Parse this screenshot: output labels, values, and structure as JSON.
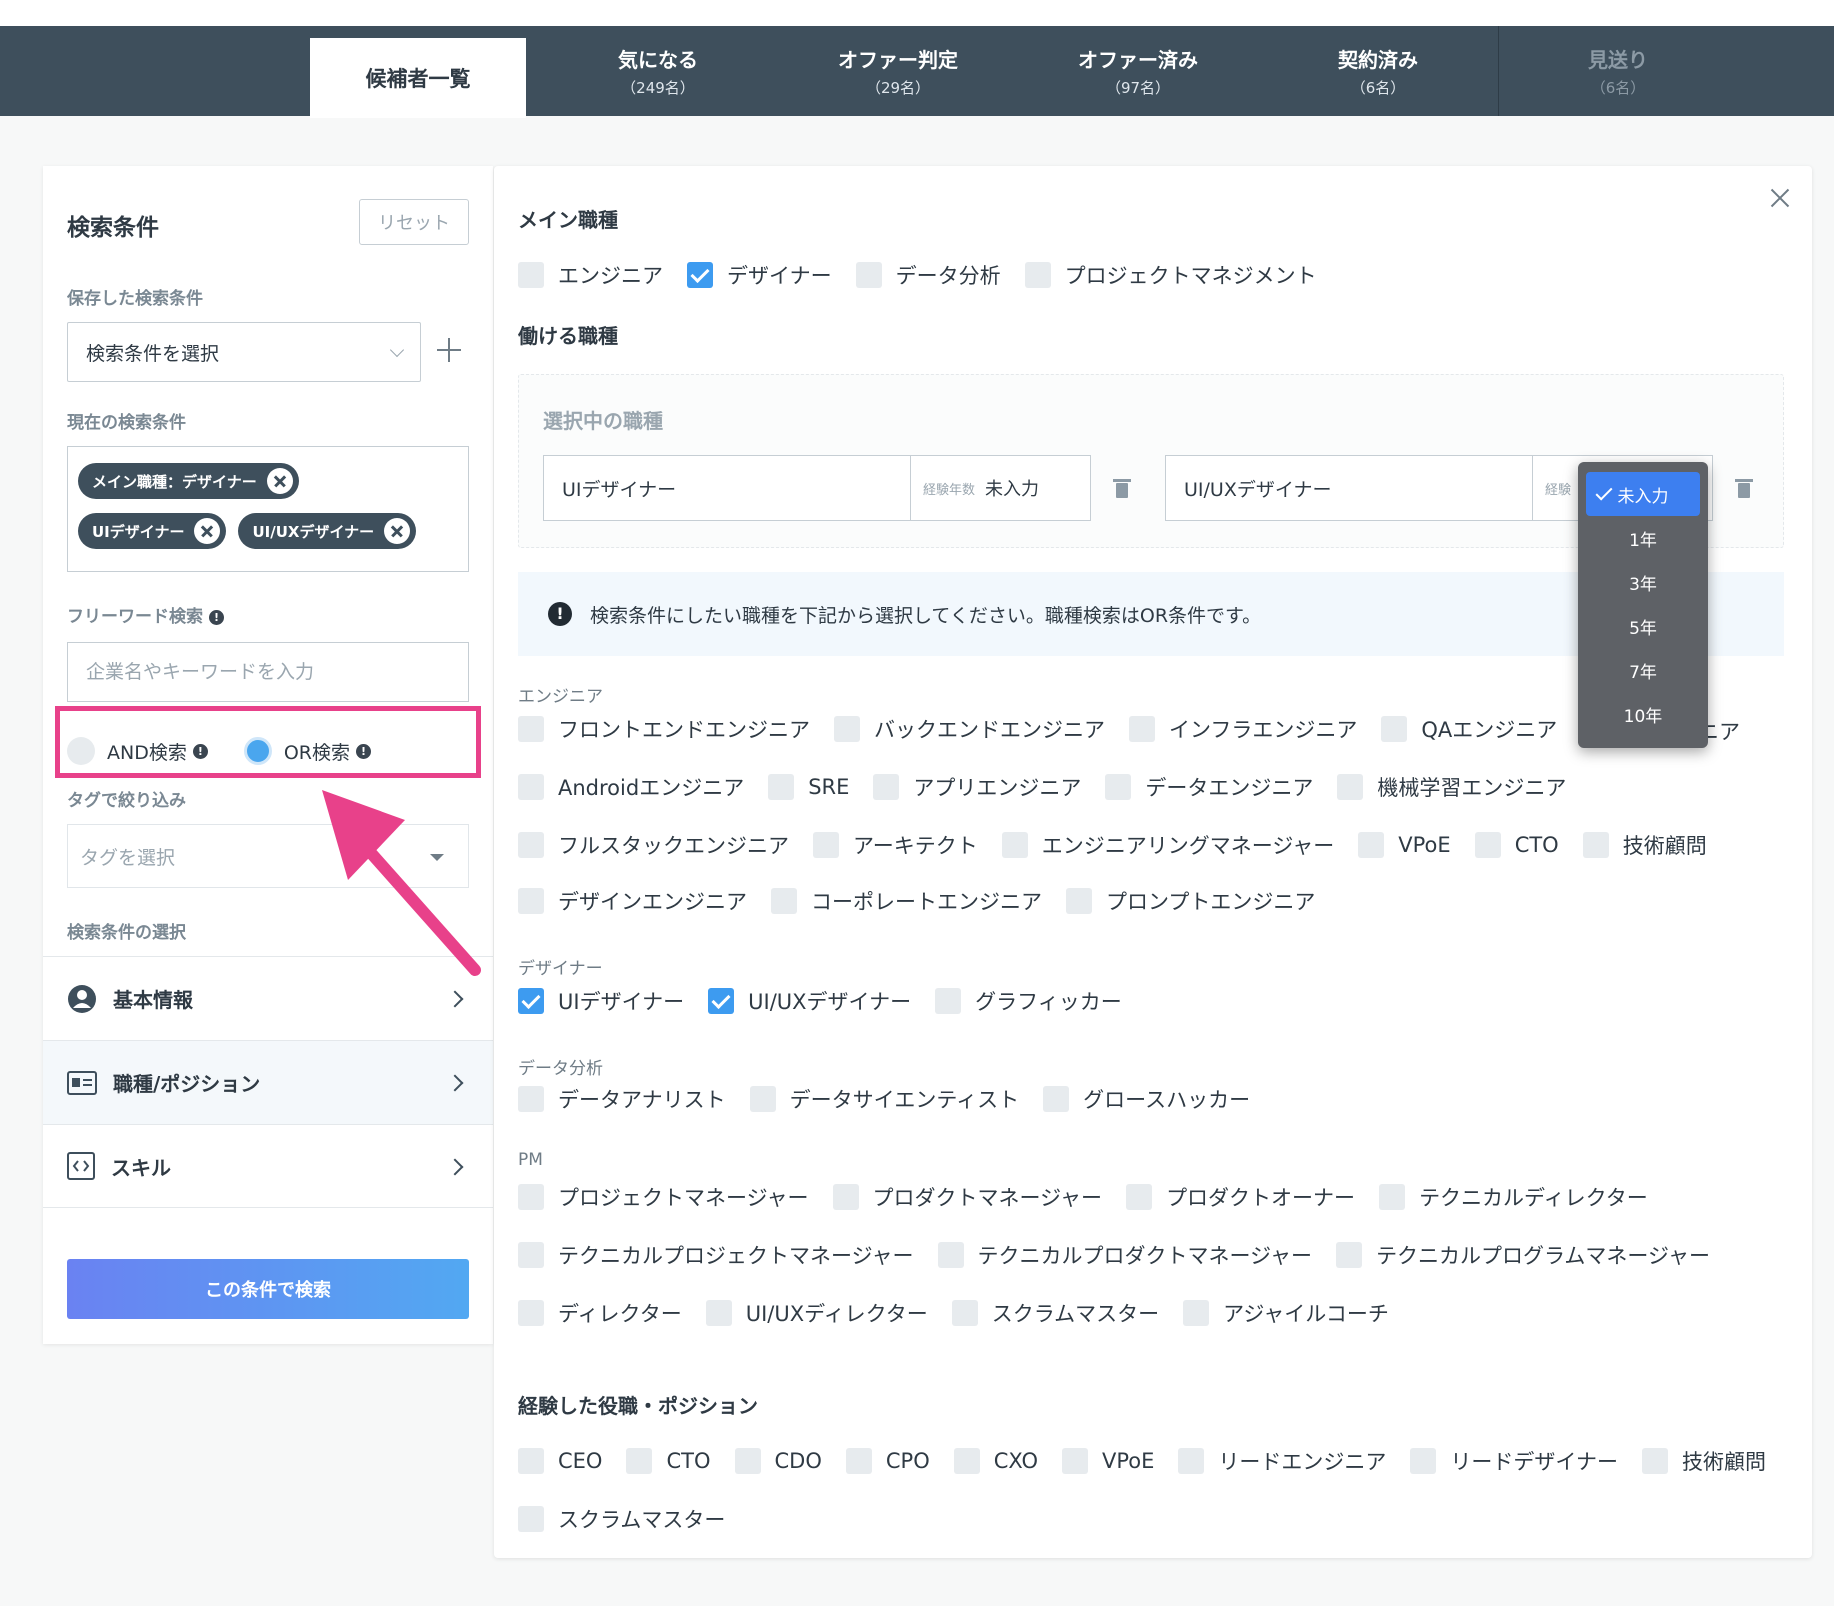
{
  "tabs": [
    {
      "label": "候補者一覧",
      "count": ""
    },
    {
      "label": "気になる",
      "count": "（249名）"
    },
    {
      "label": "オファー判定",
      "count": "（29名）"
    },
    {
      "label": "オファー済み",
      "count": "（97名）"
    },
    {
      "label": "契約済み",
      "count": "（6名）"
    },
    {
      "label": "見送り",
      "count": "（6名）"
    }
  ],
  "left": {
    "title": "検索条件",
    "reset_label": "リセット",
    "saved_label": "保存した検索条件",
    "saved_select_value": "検索条件を選択",
    "current_label": "現在の検索条件",
    "chips": [
      "メイン職種：デザイナー",
      "UIデザイナー",
      "UI/UXデザイナー"
    ],
    "freeword_label": "フリーワード検索",
    "freeword_placeholder": "企業名やキーワードを入力",
    "and_label": "AND検索",
    "or_label": "OR検索",
    "tag_label": "タグで絞り込み",
    "tag_placeholder": "タグを選択",
    "conditions_label": "検索条件の選択",
    "menu": [
      "基本情報",
      "職種/ポジション",
      "スキル"
    ],
    "search_button": "この条件で検索"
  },
  "right": {
    "main_role_title": "メイン職種",
    "main_roles": [
      {
        "label": "エンジニア",
        "checked": false
      },
      {
        "label": "デザイナー",
        "checked": true
      },
      {
        "label": "データ分析",
        "checked": false
      },
      {
        "label": "プロジェクトマネジメント",
        "checked": false
      }
    ],
    "work_role_title": "働ける職種",
    "selected_title": "選択中の職種",
    "selected_roles": [
      {
        "name": "UIデザイナー",
        "exp_label": "経験年数",
        "exp_value": "未入力"
      },
      {
        "name": "UI/UXデザイナー",
        "exp_label": "経験",
        "exp_value": ""
      }
    ],
    "notice": "検索条件にしたい職種を下記から選択してください。職種検索はOR条件です。",
    "engineer_label": "エンジニア",
    "engineer_rows": [
      [
        "フロントエンドエンジニア",
        "バックエンドエンジニア",
        "インフラエンジニア",
        "QAエンジニア",
        "ニア"
      ],
      [
        "Androidエンジニア",
        "SRE",
        "アプリエンジニア",
        "データエンジニア",
        "機械学習エンジニア"
      ],
      [
        "フルスタックエンジニア",
        "アーキテクト",
        "エンジニアリングマネージャー",
        "VPoE",
        "CTO",
        "技術顧問"
      ],
      [
        "デザインエンジニア",
        "コーポレートエンジニア",
        "プロンプトエンジニア"
      ]
    ],
    "designer_label": "デザイナー",
    "designer_items": [
      {
        "label": "UIデザイナー",
        "checked": true
      },
      {
        "label": "UI/UXデザイナー",
        "checked": true
      },
      {
        "label": "グラフィッカー",
        "checked": false
      }
    ],
    "data_label": "データ分析",
    "data_items": [
      "データアナリスト",
      "データサイエンティスト",
      "グロースハッカー"
    ],
    "pm_label": "PM",
    "pm_rows": [
      [
        "プロジェクトマネージャー",
        "プロダクトマネージャー",
        "プロダクトオーナー",
        "テクニカルディレクター"
      ],
      [
        "テクニカルプロジェクトマネージャー",
        "テクニカルプロダクトマネージャー",
        "テクニカルプログラムマネージャー"
      ],
      [
        "ディレクター",
        "UI/UXディレクター",
        "スクラムマスター",
        "アジャイルコーチ"
      ]
    ],
    "exp_title": "経験した役職・ポジション",
    "exp_rows": [
      [
        "CEO",
        "CTO",
        "CDO",
        "CPO",
        "CXO",
        "VPoE",
        "リードエンジニア",
        "リードデザイナー",
        "技術顧問"
      ],
      [
        "スクラムマスター"
      ]
    ]
  },
  "dropdown": {
    "options": [
      "未入力",
      "1年",
      "3年",
      "5年",
      "7年",
      "10年"
    ],
    "selected": "未入力"
  },
  "colors": {
    "topbar": "#3e4f5c",
    "accent": "#3d9bf0",
    "highlight": "#e8418a"
  }
}
